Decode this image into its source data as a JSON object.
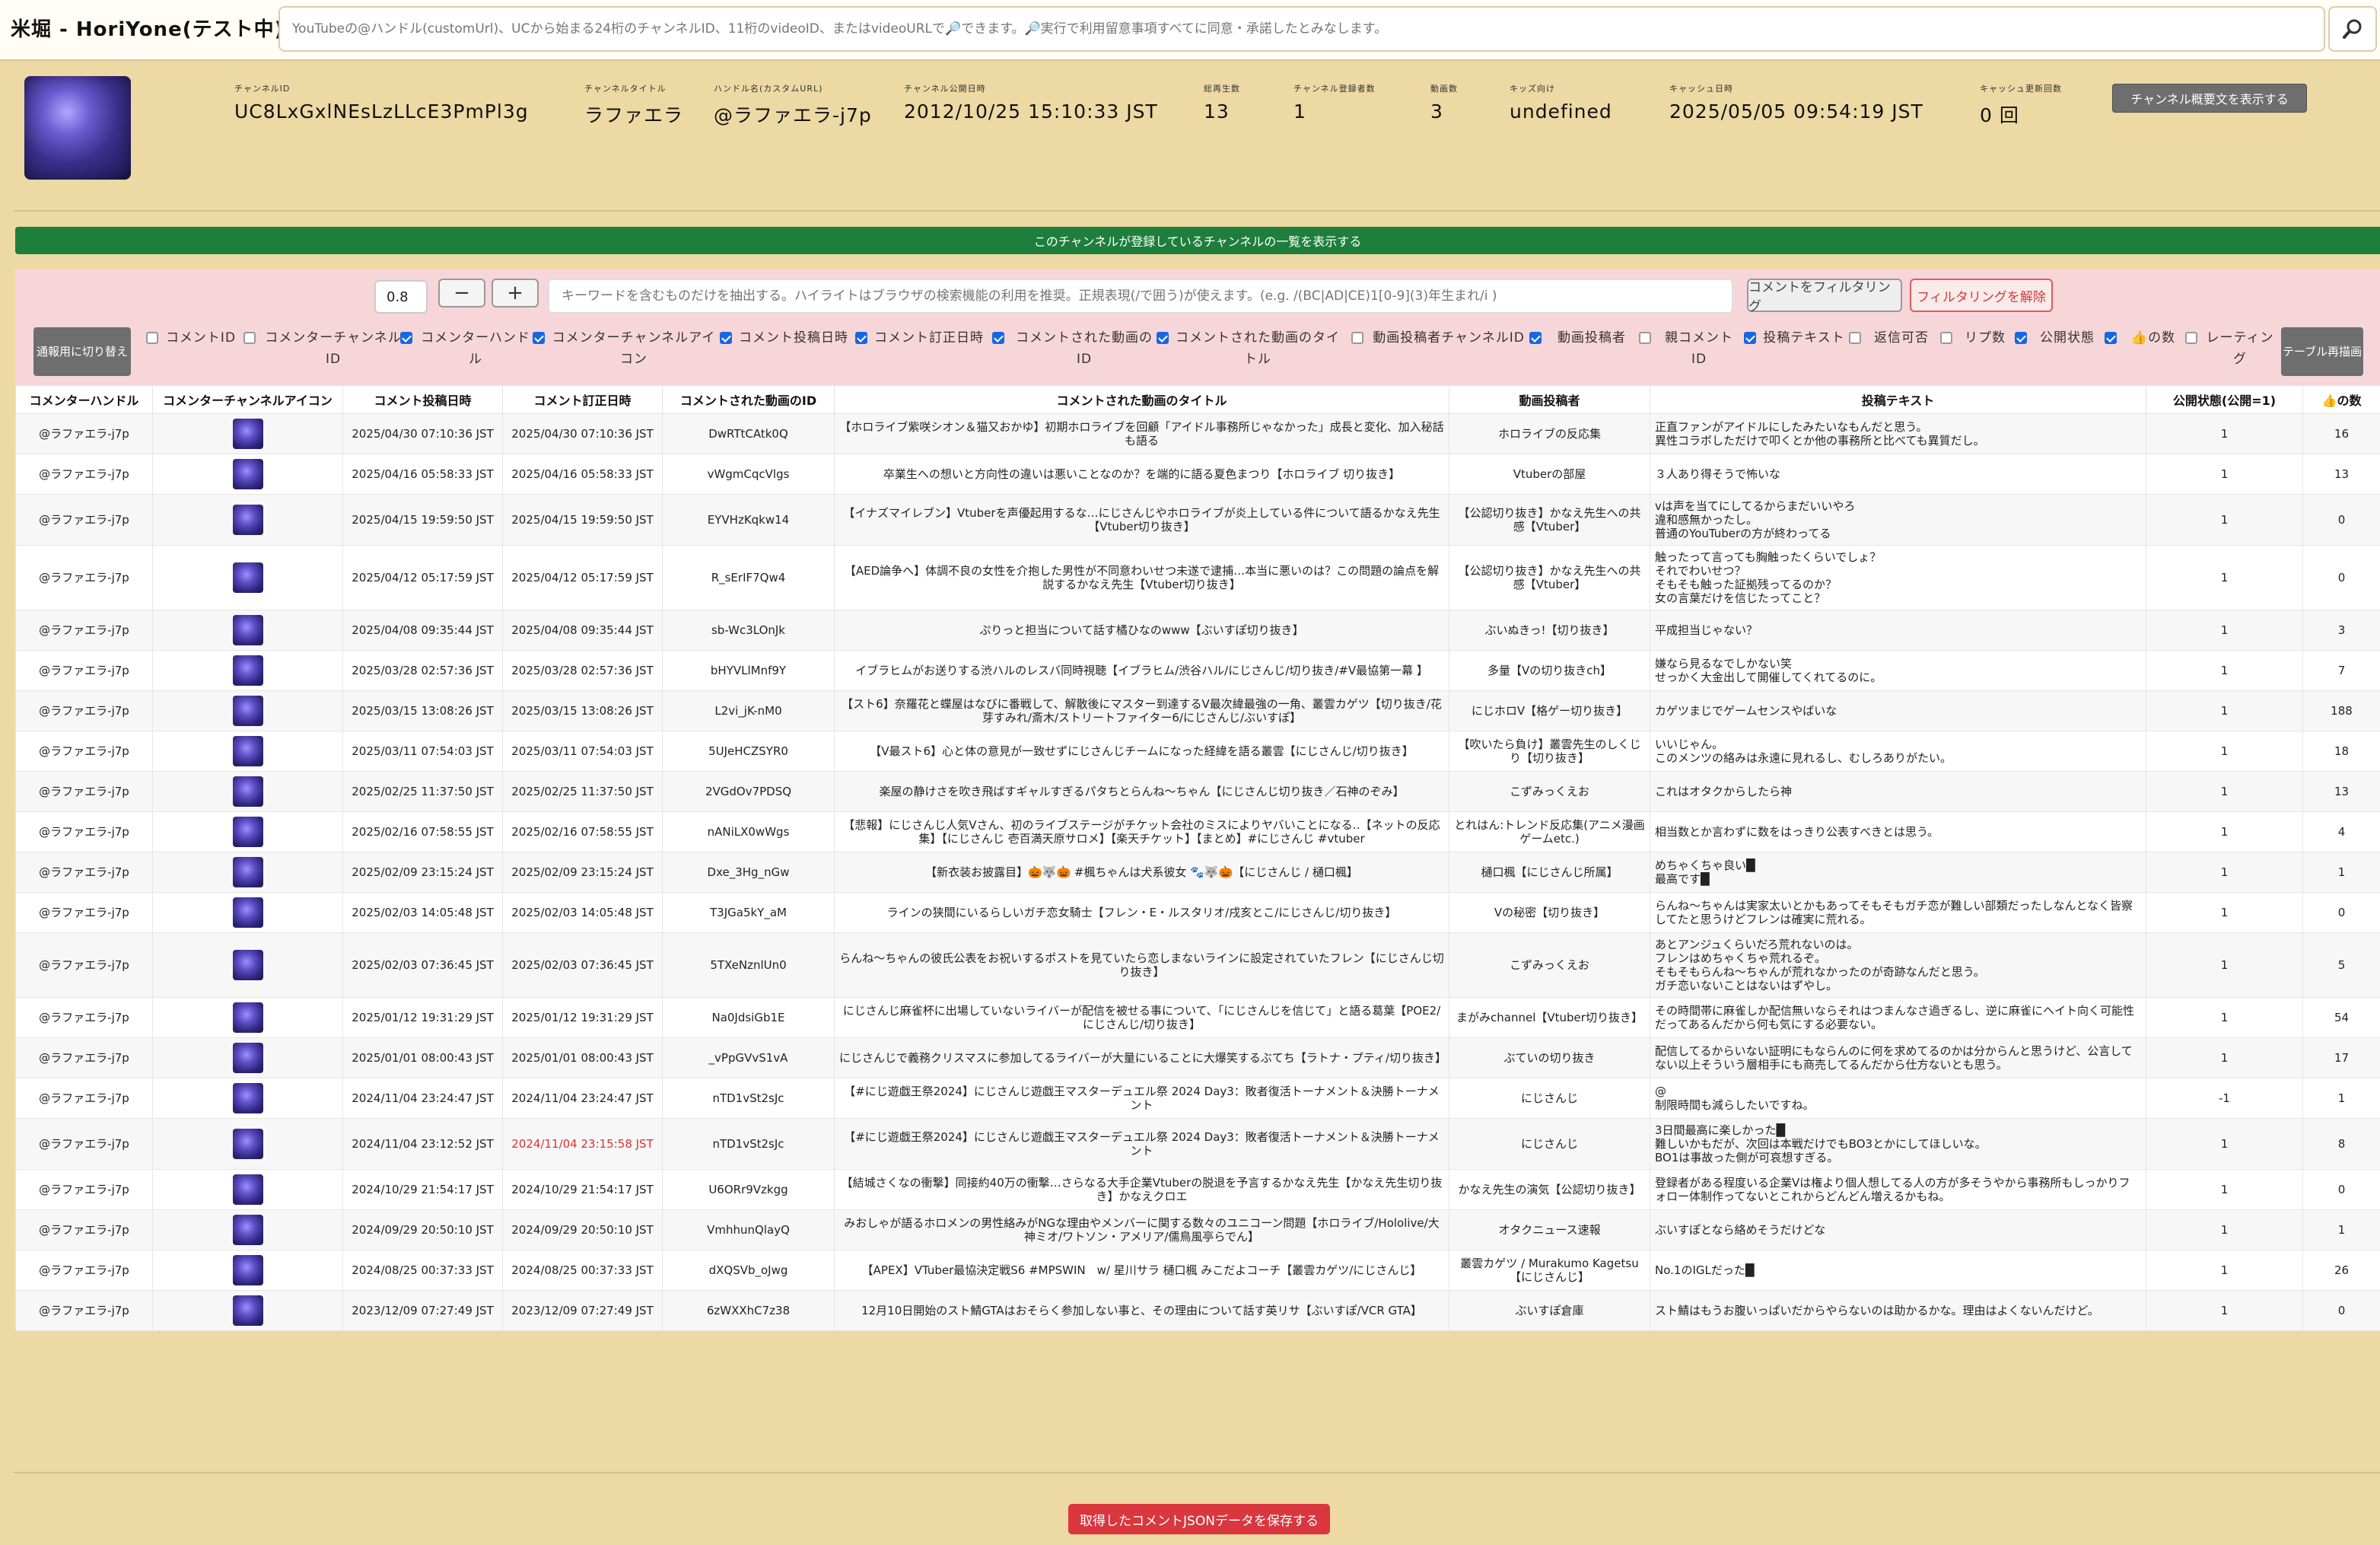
{
  "app": {
    "title": "米堀 - HoriYone(テスト中)",
    "search_placeholder": "YouTubeの@ハンドル(customUrl)、UCから始まる24桁のチャンネルID、11桁のvideoID、またはvideoURLで🔎できます。🔎実行で利用留意事項すべてに同意・承諾したとみなします。",
    "search_button_icon": "search-icon"
  },
  "channel": {
    "fields": [
      {
        "label": "チャンネルID",
        "value": "UC8LxGxlNEsLzLLcE3PmPl3g"
      },
      {
        "label": "チャンネルタイトル",
        "value": "ラファエラ"
      },
      {
        "label": "ハンドル名(カスタムURL)",
        "value": "@ラファエラ-j7p"
      },
      {
        "label": "チャンネル公開日時",
        "value": "2012/10/25 15:10:33 JST"
      },
      {
        "label": "総再生数",
        "value": "13"
      },
      {
        "label": "チャンネル登録者数",
        "value": "1"
      },
      {
        "label": "動画数",
        "value": "3"
      },
      {
        "label": "キッズ向け",
        "value": "undefined"
      },
      {
        "label": "キャッシュ日時",
        "value": "2025/05/05 09:54:19 JST"
      },
      {
        "label": "キャッシュ更新回数",
        "value": "0 回"
      }
    ],
    "summary_button": "チャンネル概要文を表示する"
  },
  "subscribed_bar": "このチャンネルが登録しているチャンネルの一覧を表示する",
  "filter": {
    "zoom_value": "0.8",
    "minus": "−",
    "plus": "+",
    "keyword_placeholder": "キーワードを含むものだけを抽出する。ハイライトはブラウザの検索機能の利用を推奨。正規表現(/で囲う)が使えます。(e.g. /(BC|AD|CE)1[0-9](3)年生まれ/i )",
    "filter_button": "コメントをフィルタリング",
    "unfilter_button": "フィルタリングを解除",
    "switch_button": "通報用に切り替え",
    "redraw_button": "テーブル再描画",
    "toggles": [
      {
        "label": "コメントID",
        "checked": false
      },
      {
        "label": "コメンターチャンネルID",
        "checked": false
      },
      {
        "label": "コメンターハンドル",
        "checked": true
      },
      {
        "label": "コメンターチャンネルアイコン",
        "checked": true
      },
      {
        "label": "コメント投稿日時",
        "checked": true
      },
      {
        "label": "コメント訂正日時",
        "checked": true
      },
      {
        "label": "コメントされた動画のID",
        "checked": true
      },
      {
        "label": "コメントされた動画のタイトル",
        "checked": true
      },
      {
        "label": "動画投稿者チャンネルID",
        "checked": false
      },
      {
        "label": "動画投稿者",
        "checked": true
      },
      {
        "label": "親コメントID",
        "checked": false
      },
      {
        "label": "投稿テキスト",
        "checked": true
      },
      {
        "label": "返信可否",
        "checked": false
      },
      {
        "label": "リプ数",
        "checked": false
      },
      {
        "label": "公開状態",
        "checked": true
      },
      {
        "label": "👍の数",
        "checked": true
      },
      {
        "label": "レーティング",
        "checked": false
      }
    ]
  },
  "table": {
    "headers": [
      "コメンターハンドル",
      "コメンターチャンネルアイコン",
      "コメント投稿日時",
      "コメント訂正日時",
      "コメントされた動画のID",
      "コメントされた動画のタイトル",
      "動画投稿者",
      "投稿テキスト",
      "公開状態(公開=1)",
      "👍の数"
    ],
    "rows": [
      {
        "handle": "@ラファエラ-j7p",
        "posted": "2025/04/30 07:10:36 JST",
        "edited": "2025/04/30 07:10:36 JST",
        "video_id": "DwRTtCAtk0Q",
        "title": "【ホロライブ紫咲シオン＆猫又おかゆ】初期ホロライブを回顧「アイドル事務所じゃなかった」成長と変化、加入秘話も語る",
        "uploader": "ホロライブの反応集",
        "text": "正直ファンがアイドルにしたみたいなもんだと思う。\n異性コラボしただけで叩くとか他の事務所と比べても異質だし。",
        "public": "1",
        "likes": "16"
      },
      {
        "handle": "@ラファエラ-j7p",
        "posted": "2025/04/16 05:58:33 JST",
        "edited": "2025/04/16 05:58:33 JST",
        "video_id": "vWgmCqcVlgs",
        "title": "卒業生への想いと方向性の違いは悪いことなのか？を端的に語る夏色まつり【ホロライブ 切り抜き】",
        "uploader": "Vtuberの部屋",
        "text": "３人あり得そうで怖いな",
        "public": "1",
        "likes": "13"
      },
      {
        "handle": "@ラファエラ-j7p",
        "posted": "2025/04/15 19:59:50 JST",
        "edited": "2025/04/15 19:59:50 JST",
        "video_id": "EYVHzKqkw14",
        "title": "【イナズマイレブン】Vtuberを声優起用するな…にじさんじやホロライブが炎上している件について語るかなえ先生【Vtuber切り抜き】",
        "uploader": "【公認切り抜き】かなえ先生への共感【Vtuber】",
        "text": "vは声を当てにしてるからまだいいやろ\n違和感無かったし。\n普通のYouTuberの方が終わってる",
        "public": "1",
        "likes": "0"
      },
      {
        "handle": "@ラファエラ-j7p",
        "posted": "2025/04/12 05:17:59 JST",
        "edited": "2025/04/12 05:17:59 JST",
        "video_id": "R_sErIF7Qw4",
        "title": "【AED論争へ】体調不良の女性を介抱した男性が不同意わいせつ未遂で逮捕…本当に悪いのは？この問題の論点を解説するかなえ先生【Vtuber切り抜き】",
        "uploader": "【公認切り抜き】かなえ先生への共感【Vtuber】",
        "text": "触ったって言っても胸触ったくらいでしょ？\nそれでわいせつ？\nそもそも触った証拠残ってるのか？\n女の言葉だけを信じたってこと？",
        "public": "1",
        "likes": "0"
      },
      {
        "handle": "@ラファエラ-j7p",
        "posted": "2025/04/08 09:35:44 JST",
        "edited": "2025/04/08 09:35:44 JST",
        "video_id": "sb-Wc3LOnJk",
        "title": "ぷりっと担当について話す橘ひなのwww【ぶいすぽ切り抜き】",
        "uploader": "ぶいぬきっ!【切り抜き】",
        "text": "平成担当じゃない？",
        "public": "1",
        "likes": "3"
      },
      {
        "handle": "@ラファエラ-j7p",
        "posted": "2025/03/28 02:57:36 JST",
        "edited": "2025/03/28 02:57:36 JST",
        "video_id": "bHYVLlMnf9Y",
        "title": "イブラヒムがお送りする渋ハルのレスバ同時視聴【イブラヒム/渋谷ハル/にじさんじ/切り抜き/#V最協第一幕 】",
        "uploader": "多量【Vの切り抜きch】",
        "text": "嫌なら見るなでしかない笑\nせっかく大金出して開催してくれてるのに。",
        "public": "1",
        "likes": "7"
      },
      {
        "handle": "@ラファエラ-j7p",
        "posted": "2025/03/15 13:08:26 JST",
        "edited": "2025/03/15 13:08:26 JST",
        "video_id": "L2vi_jK-nM0",
        "title": "【スト6】奈羅花と蝶屋はなびに番戦して、解散後にマスター到達するV最次緯最強の一角、叢雲カゲツ【切り抜き/花芽すみれ/斎木/ストリートファイター6/にじさんじ/ぶいすぽ】",
        "uploader": "にじホロV【格ゲー切り抜き】",
        "text": "カゲツまじでゲームセンスやばいな",
        "public": "1",
        "likes": "188"
      },
      {
        "handle": "@ラファエラ-j7p",
        "posted": "2025/03/11 07:54:03 JST",
        "edited": "2025/03/11 07:54:03 JST",
        "video_id": "5UJeHCZSYR0",
        "title": "【V最スト6】心と体の意見が一致せずにじさんじチームになった経緯を語る叢雲【にじさんじ/切り抜き】",
        "uploader": "【吹いたら負け】叢雲先生のしくじり【切り抜き】",
        "text": "いいじゃん。\nこのメンツの絡みは永遠に見れるし、むしろありがたい。",
        "public": "1",
        "likes": "18"
      },
      {
        "handle": "@ラファエラ-j7p",
        "posted": "2025/02/25 11:37:50 JST",
        "edited": "2025/02/25 11:37:50 JST",
        "video_id": "2VGdOv7PDSQ",
        "title": "楽屋の静けさを吹き飛ばすギャルすぎるパタちとらんね〜ちゃん【にじさんじ切り抜き／石神のぞみ】",
        "uploader": "こずみっくえお",
        "text": "これはオタクからしたら神",
        "public": "1",
        "likes": "13"
      },
      {
        "handle": "@ラファエラ-j7p",
        "posted": "2025/02/16 07:58:55 JST",
        "edited": "2025/02/16 07:58:55 JST",
        "video_id": "nANiLX0wWgs",
        "title": "【悲報】にじさんじ人気Vさん、初のライブステージがチケット会社のミスによりヤバいことになる‥【ネットの反応集】【にじさんじ 壱百満天原サロメ】【楽天チケット】【まとめ】#にじさんじ #vtuber",
        "uploader": "とれはん:トレンド反応集(アニメ漫画ゲームetc.)",
        "text": "相当数とか言わずに数をはっきり公表すべきとは思う。",
        "public": "1",
        "likes": "4"
      },
      {
        "handle": "@ラファエラ-j7p",
        "posted": "2025/02/09 23:15:24 JST",
        "edited": "2025/02/09 23:15:24 JST",
        "video_id": "Dxe_3Hg_nGw",
        "title": "【新衣装お披露目】🎃🐺🎃 #楓ちゃんは犬系彼女 🐾🐺🎃【にじさんじ / 樋口楓】",
        "uploader": "樋口楓【にじさんじ所属】",
        "text": "めちゃくちゃ良い█\n最高です█",
        "public": "1",
        "likes": "1"
      },
      {
        "handle": "@ラファエラ-j7p",
        "posted": "2025/02/03 14:05:48 JST",
        "edited": "2025/02/03 14:05:48 JST",
        "video_id": "T3JGa5kY_aM",
        "title": "ラインの狭間にいるらしいガチ恋女騎士【フレン・E・ルスタリオ/戌亥とこ/にじさんじ/切り抜き】",
        "uploader": "Vの秘密【切り抜き】",
        "text": "らんね〜ちゃんは実家太いとかもあってそもそもガチ恋が難しい部類だったしなんとなく皆察してたと思うけどフレンは確実に荒れる。",
        "public": "1",
        "likes": "0"
      },
      {
        "handle": "@ラファエラ-j7p",
        "posted": "2025/02/03 07:36:45 JST",
        "edited": "2025/02/03 07:36:45 JST",
        "video_id": "5TXeNznlUn0",
        "title": "らんね〜ちゃんの彼氏公表をお祝いするポストを見ていたら恋しまないラインに設定されていたフレン【にじさんじ切り抜き】",
        "uploader": "こずみっくえお",
        "text": "あとアンジュくらいだろ荒れないのは。\nフレンはめちゃくちゃ荒れるぞ。\nそもそもらんね〜ちゃんが荒れなかったのが奇跡なんだと思う。\nガチ恋いないことはないはずやし。",
        "public": "1",
        "likes": "5"
      },
      {
        "handle": "@ラファエラ-j7p",
        "posted": "2025/01/12 19:31:29 JST",
        "edited": "2025/01/12 19:31:29 JST",
        "video_id": "Na0JdsiGb1E",
        "title": "にじさんじ麻雀杯に出場していないライバーが配信を被せる事について、「にじさんじを信じて」と語る葛葉【POE2/にじさんじ/切り抜き】",
        "uploader": "まがみchannel【Vtuber切り抜き】",
        "text": "その時間帯に麻雀しか配信無いならそれはつまんなさ過ぎるし、逆に麻雀にヘイト向く可能性だってあるんだから何も気にする必要ない。",
        "public": "1",
        "likes": "54"
      },
      {
        "handle": "@ラファエラ-j7p",
        "posted": "2025/01/01 08:00:43 JST",
        "edited": "2025/01/01 08:00:43 JST",
        "video_id": "_vPpGVvS1vA",
        "title": "にじさんじで義務クリスマスに参加してるライバーが大量にいることに大爆笑するぶてち【ラトナ・プティ/切り抜き】",
        "uploader": "ぶていの切り抜き",
        "text": "配信してるからいない証明にもならんのに何を求めてるのかは分からんと思うけど、公言してない以上そういう層相手にも商売してるんだから仕方ないとも思う。",
        "public": "1",
        "likes": "17"
      },
      {
        "handle": "@ラファエラ-j7p",
        "posted": "2024/11/04 23:24:47 JST",
        "edited": "2024/11/04 23:24:47 JST",
        "video_id": "nTD1vSt2sJc",
        "title": "【#にじ遊戯王祭2024】にじさんじ遊戯王マスターデュエル祭 2024 Day3：敗者復活トーナメント＆決勝トーナメント",
        "uploader": "にじさんじ",
        "text": "@\n制限時間も減らしたいですね。",
        "public": "-1",
        "likes": "1"
      },
      {
        "handle": "@ラファエラ-j7p",
        "posted": "2024/11/04 23:12:52 JST",
        "edited": "2024/11/04 23:15:58 JST",
        "edited_red": true,
        "video_id": "nTD1vSt2sJc",
        "title": "【#にじ遊戯王祭2024】にじさんじ遊戯王マスターデュエル祭 2024 Day3：敗者復活トーナメント＆決勝トーナメント",
        "uploader": "にじさんじ",
        "text": "3日間最高に楽しかった█\n難しいかもだが、次回は本戦だけでもBO3とかにしてほしいな。\nBO1は事故った側が可哀想すぎる。",
        "public": "1",
        "likes": "8"
      },
      {
        "handle": "@ラファエラ-j7p",
        "posted": "2024/10/29 21:54:17 JST",
        "edited": "2024/10/29 21:54:17 JST",
        "video_id": "U6ORr9Vzkgg",
        "title": "【結城さくなの衝撃】同接約40万の衝撃…さらなる大手企業Vtuberの脱退を予言するかなえ先生【かなえ先生切り抜き】かなえクロエ",
        "uploader": "かなえ先生の演気【公認切り抜き】",
        "text": "登録者がある程度いる企業Vは権より個人想してる人の方が多そうやから事務所もしっかりフォロー体制作ってないとこれからどんどん増えるかもね。",
        "public": "1",
        "likes": "0"
      },
      {
        "handle": "@ラファエラ-j7p",
        "posted": "2024/09/29 20:50:10 JST",
        "edited": "2024/09/29 20:50:10 JST",
        "video_id": "VmhhunQlayQ",
        "title": "みおしゃが語るホロメンの男性絡みがNGな理由やメンバーに関する数々のユニコーン問題【ホロライブ/Hololive/大神ミオ/ワトソン・アメリア/儒鳥風亭らでん】",
        "uploader": "オタクニュース速報",
        "text": "ぶいすぽとなら絡めそうだけどな",
        "public": "1",
        "likes": "1"
      },
      {
        "handle": "@ラファエラ-j7p",
        "posted": "2024/08/25 00:37:33 JST",
        "edited": "2024/08/25 00:37:33 JST",
        "video_id": "dXQSVb_oJwg",
        "title": "【APEX】VTuber最協決定戦S6 #MPSWIN　w/ 星川サラ 樋口楓 みこだよコーチ【叢雲カゲツ/にじさんじ】",
        "uploader": "叢雲カゲツ / Murakumo Kagetsu【にじさんじ】",
        "text": "No.1のIGLだった█",
        "public": "1",
        "likes": "26"
      },
      {
        "handle": "@ラファエラ-j7p",
        "posted": "2023/12/09 07:27:49 JST",
        "edited": "2023/12/09 07:27:49 JST",
        "video_id": "6zWXXhC7z38",
        "title": "12月10日開始のスト鯖GTAはおそらく参加しない事と、その理由について話す英リサ【ぶいすぽ/VCR GTA】",
        "uploader": "ぶいすぽ倉庫",
        "text": "スト鯖はもうお腹いっぱいだからやらないのは助かるかな。理由はよくないんだけど。",
        "public": "1",
        "likes": "0"
      }
    ]
  },
  "save_button": "取得したコメントJSONデータを保存する"
}
